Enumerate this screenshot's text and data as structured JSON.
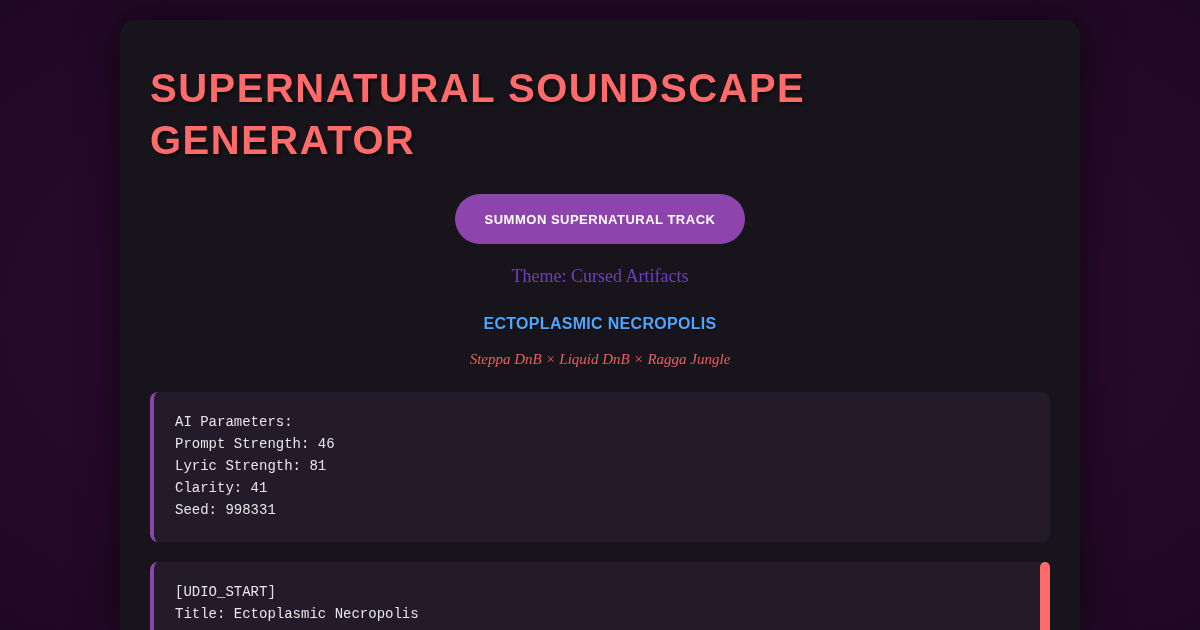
{
  "title": "SUPERNATURAL SOUNDSCAPE GENERATOR",
  "summon_button": {
    "label": "SUMMON SUPERNATURAL TRACK"
  },
  "theme": "Theme: Cursed Artifacts",
  "track": {
    "title": "ECTOPLASMIC NECROPOLIS",
    "genres": "Steppa DnB × Liquid DnB × Ragga Jungle"
  },
  "parameters_block": {
    "lines": [
      "AI Parameters:",
      "Prompt Strength: 46",
      "Lyric Strength: 81",
      "Clarity: 41",
      "Seed: 998331"
    ]
  },
  "udio_block": {
    "lines": [
      "[UDIO_START]",
      "Title: Ectoplasmic Necropolis"
    ]
  }
}
